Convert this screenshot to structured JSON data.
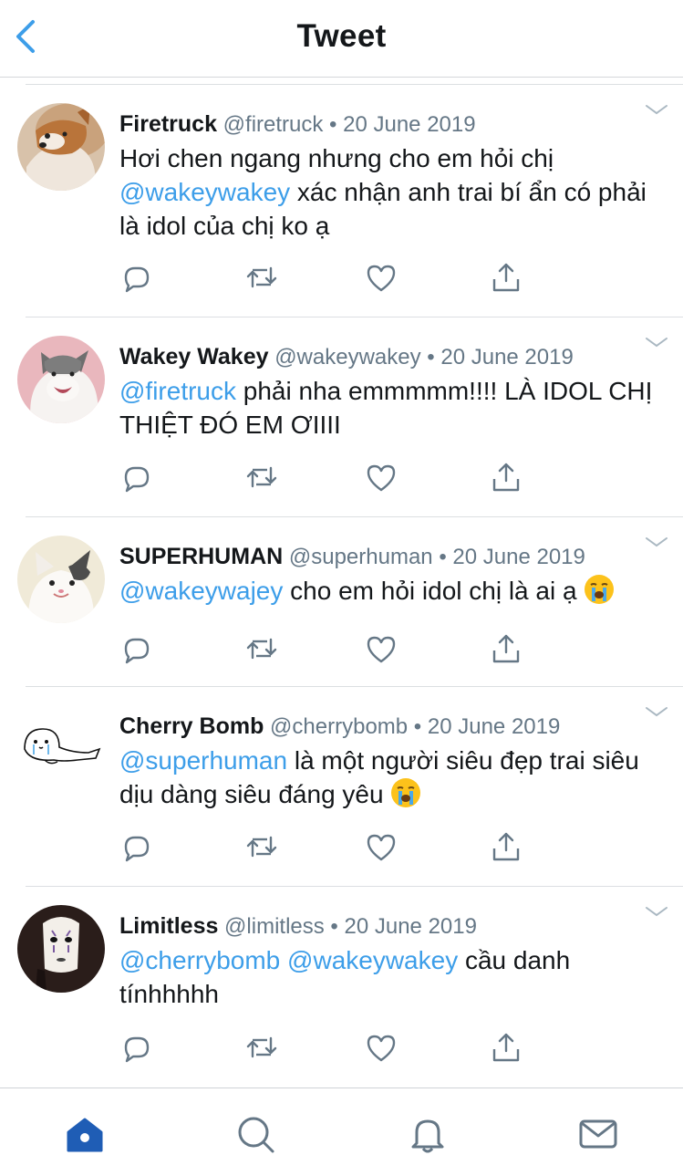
{
  "header": {
    "title": "Tweet"
  },
  "tweets": [
    {
      "name": "Firetruck",
      "handle": "@firetruck",
      "date": "20 June 2019",
      "mention1": "",
      "text1": "Hơi chen ngang nhưng cho em hỏi chị ",
      "mention2": "@wakeywakey",
      "text2": " xác nhận anh trai bí ẩn có phải là idol của chị ko ạ",
      "emoji": ""
    },
    {
      "name": "Wakey Wakey",
      "handle": "@wakeywakey",
      "date": "20 June 2019",
      "mention1": "@firetruck",
      "text1": " phải nha emmmmm!!!! LÀ IDOL CHỊ THIỆT ĐÓ EM ƠIIII",
      "mention2": "",
      "text2": "",
      "emoji": ""
    },
    {
      "name": "SUPERHUMAN",
      "handle": "@superhuman",
      "date": "20 June 2019",
      "mention1": "@wakeywajey",
      "text1": " cho em hỏi idol chị là ai ạ ",
      "mention2": "",
      "text2": "",
      "emoji": "crying-face"
    },
    {
      "name": "Cherry Bomb",
      "handle": "@cherrybomb",
      "date": "20 June 2019",
      "mention1": "@superhuman",
      "text1": " là một người siêu đẹp trai siêu dịu dàng siêu đáng yêu ",
      "mention2": "",
      "text2": "",
      "emoji": "crying-face"
    },
    {
      "name": "Limitless",
      "handle": "@limitless",
      "date": "20 June 2019",
      "mention1": "@cherrybomb",
      "text1": " ",
      "mention2": "@wakeywakey",
      "text2": " cầu danh tínhhhhh",
      "emoji": ""
    }
  ],
  "meta_separator": "•",
  "colors": {
    "accent": "#1da1f2",
    "mention": "#3d9ee9",
    "muted": "#657786",
    "icon": "#657786",
    "tab_active": "#1f5db5"
  },
  "icons": {
    "back": "chevron-left-icon",
    "reply": "reply-icon",
    "retweet": "retweet-icon",
    "like": "heart-icon",
    "share": "share-icon",
    "caret": "chevron-down-icon",
    "tabs": [
      "home-icon",
      "search-icon",
      "bell-icon",
      "mail-icon"
    ]
  }
}
